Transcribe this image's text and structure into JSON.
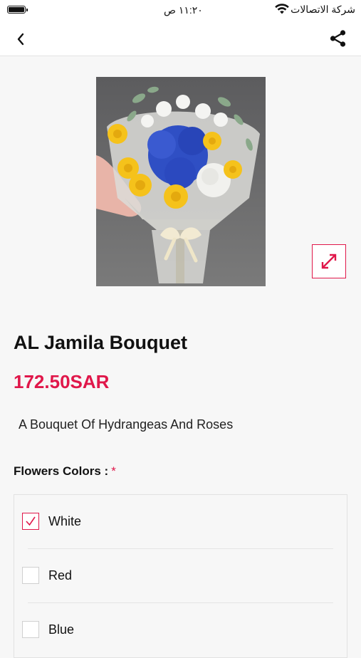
{
  "status_bar": {
    "time": "١١:٢٠ ص",
    "carrier": "شركة الاتصالات"
  },
  "icons": {
    "back": "chevron-left-icon",
    "share": "share-icon",
    "expand": "expand-icon",
    "check": "checkmark-icon"
  },
  "colors": {
    "accent": "#e0174a",
    "background": "#f7f7f7"
  },
  "product": {
    "name": "AL Jamila Bouquet",
    "price": "172.50SAR",
    "description": "A Bouquet Of Hydrangeas And Roses"
  },
  "options": {
    "label": "Flowers Colors :",
    "required_mark": "*",
    "items": [
      {
        "label": "White",
        "checked": true
      },
      {
        "label": "Red",
        "checked": false
      },
      {
        "label": "Blue",
        "checked": false
      }
    ]
  }
}
